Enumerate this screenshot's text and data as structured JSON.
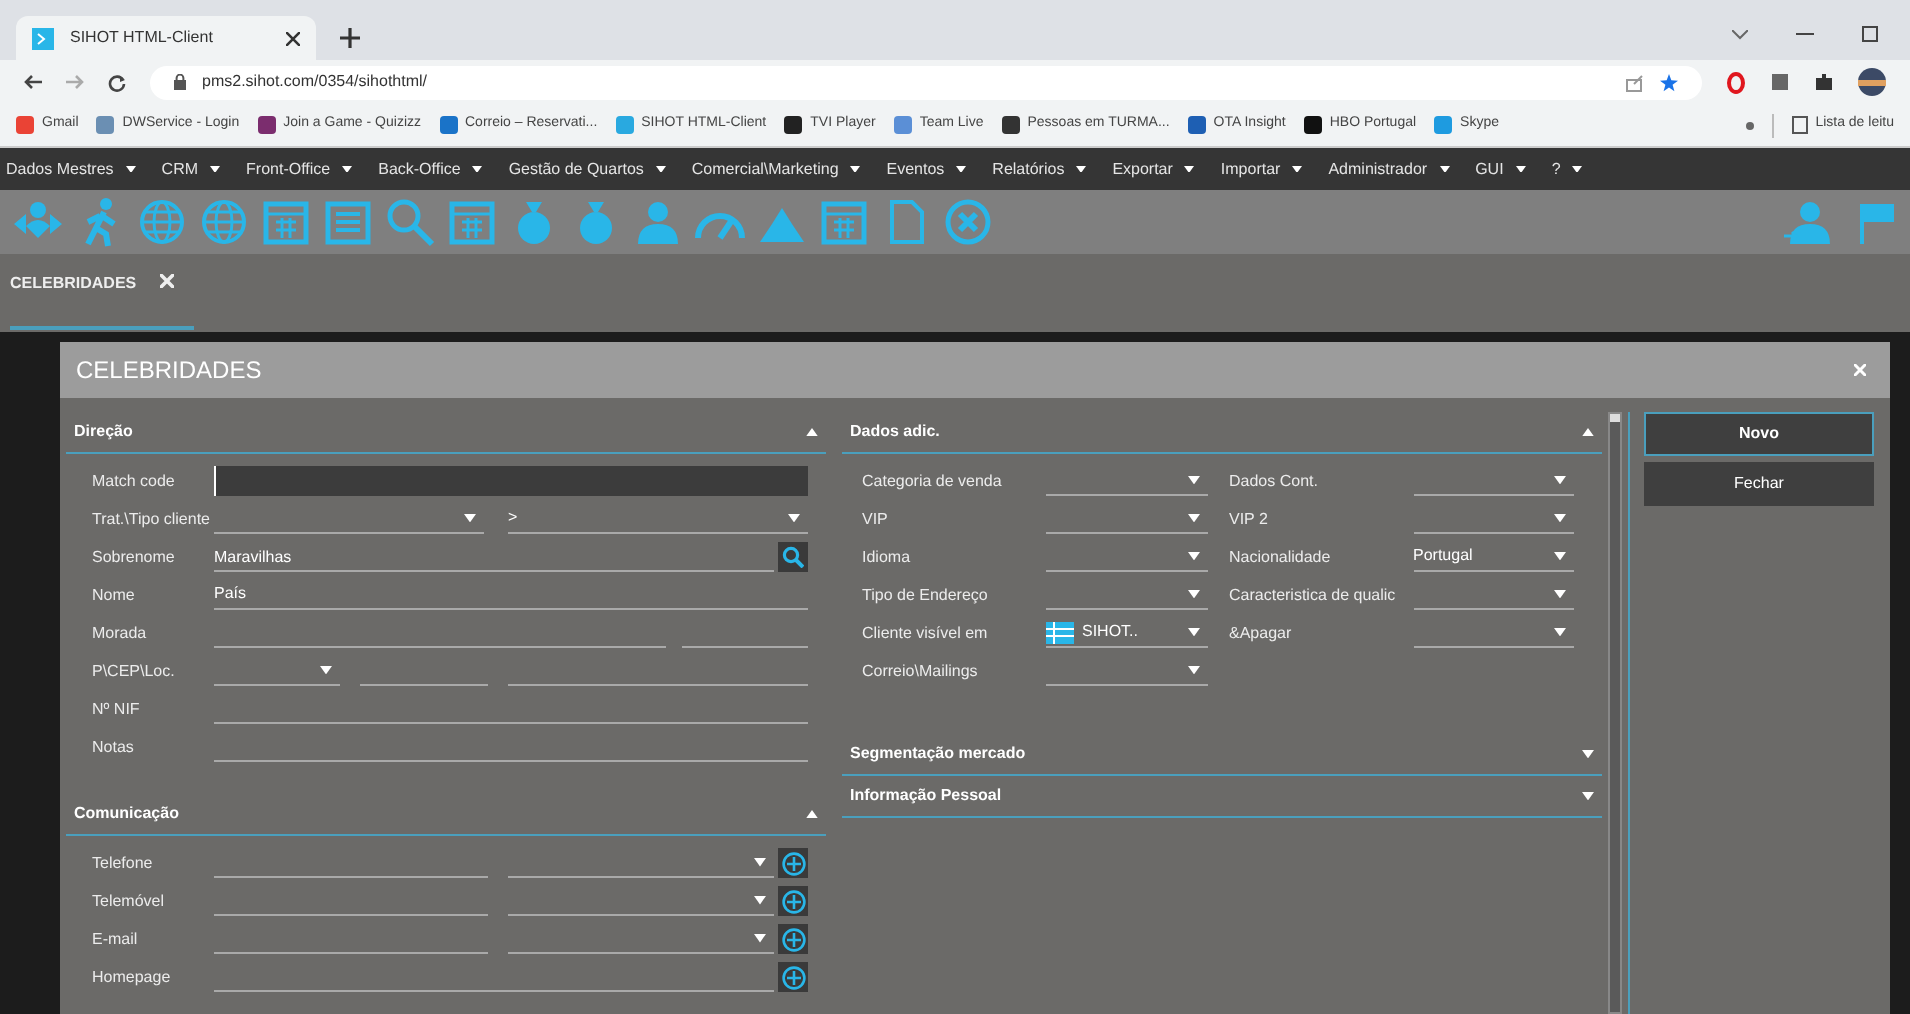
{
  "browser": {
    "tab_title": "SIHOT HTML-Client",
    "url": "pms2.sihot.com/0354/sihothtml/",
    "bookmarks": [
      {
        "label": "Gmail",
        "color": "#ea4335"
      },
      {
        "label": "DWService - Login",
        "color": "#6b8fb3"
      },
      {
        "label": "Join a Game - Quizizz",
        "color": "#7b2d6e"
      },
      {
        "label": "Correio – Reservati...",
        "color": "#1a73c8"
      },
      {
        "label": "SIHOT HTML-Client",
        "color": "#29a9e0"
      },
      {
        "label": "TVI Player",
        "color": "#222222"
      },
      {
        "label": "Team Live",
        "color": "#5b8fd6"
      },
      {
        "label": "Pessoas em TURMA...",
        "color": "#333333"
      },
      {
        "label": "OTA Insight",
        "color": "#1e5fb3"
      },
      {
        "label": "HBO Portugal",
        "color": "#111111"
      },
      {
        "label": "Skype",
        "color": "#1e9be0"
      }
    ],
    "reading_list": "Lista de leitu"
  },
  "menu": [
    "Dados Mestres",
    "CRM",
    "Front-Office",
    "Back-Office",
    "Gestão de Quartos",
    "Comercial\\Marketing",
    "Eventos",
    "Relatórios",
    "Exportar",
    "Importar",
    "Administrador",
    "GUI",
    "?"
  ],
  "tabs": [
    {
      "label": "CELEBRIDADES",
      "selected": true
    }
  ],
  "dialog": {
    "title": "CELEBRIDADES",
    "left_sections": [
      {
        "title": "Direção",
        "expanded": true,
        "fields": [
          {
            "label": "Match code",
            "kind": "input"
          },
          {
            "label": "Trat.\\Tipo cliente",
            "kind": "double-select",
            "second_value": ">"
          },
          {
            "label": "Sobrenome",
            "kind": "search",
            "value": "Maravilhas"
          },
          {
            "label": "Nome",
            "kind": "text",
            "value": "País"
          },
          {
            "label": "Morada",
            "kind": "address"
          },
          {
            "label": "P\\CEP\\Loc.",
            "kind": "postal"
          },
          {
            "label": "Nº NIF",
            "kind": "text"
          },
          {
            "label": "Notas",
            "kind": "text"
          }
        ]
      },
      {
        "title": "Comunicação",
        "expanded": true,
        "fields": [
          {
            "label": "Telefone",
            "kind": "phone"
          },
          {
            "label": "Telemóvel",
            "kind": "phone"
          },
          {
            "label": "E-mail",
            "kind": "phone"
          },
          {
            "label": "Homepage",
            "kind": "url"
          }
        ]
      }
    ],
    "right_sections": [
      {
        "title": "Dados adic.",
        "expanded": true,
        "fields": [
          {
            "label": "Categoria de venda",
            "kind": "select"
          },
          {
            "label": "Dados Cont.",
            "kind": "select"
          },
          {
            "label": "VIP",
            "kind": "select"
          },
          {
            "label": "VIP 2",
            "kind": "select"
          },
          {
            "label": "Idioma",
            "kind": "select"
          },
          {
            "label": "Nacionalidade",
            "kind": "select",
            "value": "Portugal"
          },
          {
            "label": "Tipo de Endereço",
            "kind": "select"
          },
          {
            "label": "Caracteristica de qualic",
            "kind": "select"
          },
          {
            "label": "Cliente visível em",
            "kind": "select-list",
            "value": "SIHOT.."
          },
          {
            "label": "&Apagar",
            "kind": "select"
          },
          {
            "label": "Correio\\Mailings",
            "kind": "select"
          }
        ]
      },
      {
        "title": "Segmentação mercado",
        "expanded": false
      },
      {
        "title": "Informação Pessoal",
        "expanded": false
      }
    ],
    "buttons": [
      {
        "label": "Novo",
        "selected": true
      },
      {
        "label": "Fechar",
        "selected": false
      }
    ]
  }
}
